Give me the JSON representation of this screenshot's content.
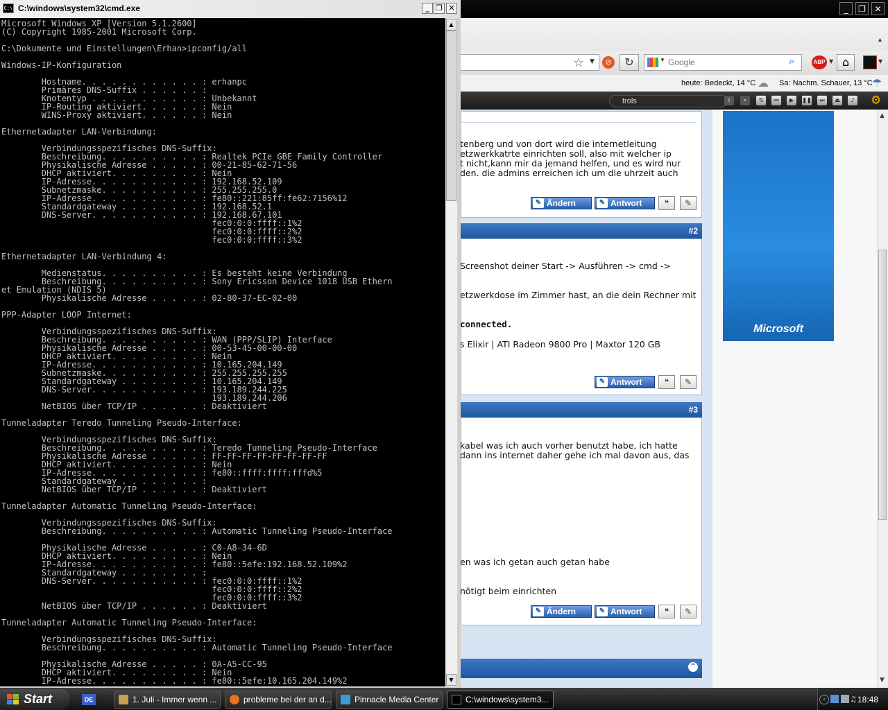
{
  "cmd": {
    "title": "C:\\windows\\system32\\cmd.exe",
    "lines": [
      "Microsoft Windows XP [Version 5.1.2600]",
      "(C) Copyright 1985-2001 Microsoft Corp.",
      "",
      "C:\\Dokumente und Einstellungen\\Erhan>ipconfig/all",
      "",
      "Windows-IP-Konfiguration",
      "",
      "        Hostname. . . . . . . . . . . . : erhanpc",
      "        Primäres DNS-Suffix . . . . . . :",
      "        Knotentyp . . . . . . . . . . . : Unbekannt",
      "        IP-Routing aktiviert. . . . . . : Nein",
      "        WINS-Proxy aktiviert. . . . . . : Nein",
      "",
      "Ethernetadapter LAN-Verbindung:",
      "",
      "        Verbindungsspezifisches DNS-Suffix:",
      "        Beschreibung. . . . . . . . . . : Realtek PCIe GBE Family Controller",
      "        Physikalische Adresse . . . . . : 00-21-85-62-71-56",
      "        DHCP aktiviert. . . . . . . . . : Nein",
      "        IP-Adresse. . . . . . . . . . . : 192.168.52.109",
      "        Subnetzmaske. . . . . . . . . . : 255.255.255.0",
      "        IP-Adresse. . . . . . . . . . . : fe80::221:85ff:fe62:7156%12",
      "        Standardgateway . . . . . . . . : 192.168.52.1",
      "        DNS-Server. . . . . . . . . . . : 192.168.67.101",
      "                                          fec0:0:0:ffff::1%2",
      "                                          fec0:0:0:ffff::2%2",
      "                                          fec0:0:0:ffff::3%2",
      "",
      "Ethernetadapter LAN-Verbindung 4:",
      "",
      "        Medienstatus. . . . . . . . . . : Es besteht keine Verbindung",
      "        Beschreibung. . . . . . . . . . : Sony Ericsson Device 1018 USB Ethern",
      "et Emulation (NDIS 5)",
      "        Physikalische Adresse . . . . . : 02-80-37-EC-02-00",
      "",
      "PPP-Adapter LOOP Internet:",
      "",
      "        Verbindungsspezifisches DNS-Suffix:",
      "        Beschreibung. . . . . . . . . . : WAN (PPP/SLIP) Interface",
      "        Physikalische Adresse . . . . . : 00-53-45-00-00-00",
      "        DHCP aktiviert. . . . . . . . . : Nein",
      "        IP-Adresse. . . . . . . . . . . : 10.165.204.149",
      "        Subnetzmaske. . . . . . . . . . : 255.255.255.255",
      "        Standardgateway . . . . . . . . : 10.165.204.149",
      "        DNS-Server. . . . . . . . . . . : 193.189.244.225",
      "                                          193.189.244.206",
      "        NetBIOS über TCP/IP . . . . . . : Deaktiviert",
      "",
      "Tunneladapter Teredo Tunneling Pseudo-Interface:",
      "",
      "        Verbindungsspezifisches DNS-Suffix:",
      "        Beschreibung. . . . . . . . . . : Teredo Tunneling Pseudo-Interface",
      "        Physikalische Adresse . . . . . : FF-FF-FF-FF-FF-FF-FF-FF",
      "        DHCP aktiviert. . . . . . . . . : Nein",
      "        IP-Adresse. . . . . . . . . . . : fe80::ffff:ffff:fffd%5",
      "        Standardgateway . . . . . . . . :",
      "        NetBIOS über TCP/IP . . . . . . : Deaktiviert",
      "",
      "Tunneladapter Automatic Tunneling Pseudo-Interface:",
      "",
      "        Verbindungsspezifisches DNS-Suffix:",
      "        Beschreibung. . . . . . . . . . : Automatic Tunneling Pseudo-Interface",
      "",
      "        Physikalische Adresse . . . . . : C0-A8-34-6D",
      "        DHCP aktiviert. . . . . . . . . : Nein",
      "        IP-Adresse. . . . . . . . . . . : fe80::5efe:192.168.52.109%2",
      "        Standardgateway . . . . . . . . :",
      "        DNS-Server. . . . . . . . . . . : fec0:0:0:ffff::1%2",
      "                                          fec0:0:0:ffff::2%2",
      "                                          fec0:0:0:ffff::3%2",
      "        NetBIOS über TCP/IP . . . . . . : Deaktiviert",
      "",
      "Tunneladapter Automatic Tunneling Pseudo-Interface:",
      "",
      "        Verbindungsspezifisches DNS-Suffix:",
      "        Beschreibung. . . . . . . . . . : Automatic Tunneling Pseudo-Interface",
      "",
      "        Physikalische Adresse . . . . . : 0A-A5-CC-95",
      "        DHCP aktiviert. . . . . . . . . : Nein",
      "        IP-Adresse. . . . . . . . . . . : fe80::5efe:10.165.204.149%2"
    ]
  },
  "browser": {
    "search_placeholder": "Google",
    "weather_today": "heute: Bedeckt, 14 °C",
    "weather_tomorrow": "Sa: Nachm. Schauer, 13 °C",
    "media_search": "trols",
    "ad_logo": "Microsoft",
    "post1": {
      "lines": [
        "tenberg und von dort wird die internetleitung",
        "etzwerkkatrte einrichten soll, also mit welcher ip",
        "t nicht,kann mir da jemand helfen, und es wird nur",
        "den. die admins erreichen ich um die uhrzeit auch"
      ]
    },
    "post2": {
      "number": "#2",
      "line1": "Screenshot deiner Start -> Ausführen -> cmd ->",
      "line2": "etzwerkdose im Zimmer hast, an die dein Rechner mit",
      "line3": "connected.",
      "line4": "s Elixir | ATI Radeon 9800 Pro | Maxtor 120 GB"
    },
    "post3": {
      "number": "#3",
      "line1": "kabel was ich auch vorher benutzt habe, ich hatte",
      "line2": "dann ins internet daher gehe ich mal davon aus, das",
      "line3": "en was ich getan auch getan habe",
      "line4": "nötigt beim einrichten"
    },
    "buttons": {
      "edit": "Ändern",
      "reply": "Antwort"
    }
  },
  "taskbar": {
    "start": "Start",
    "lang": "DE",
    "tasks": [
      "1. Juli - Immer wenn ...",
      "probleme bei der an d...",
      "Pinnacle Media Center",
      "C:\\windows\\system3..."
    ],
    "clock": "18:48"
  }
}
